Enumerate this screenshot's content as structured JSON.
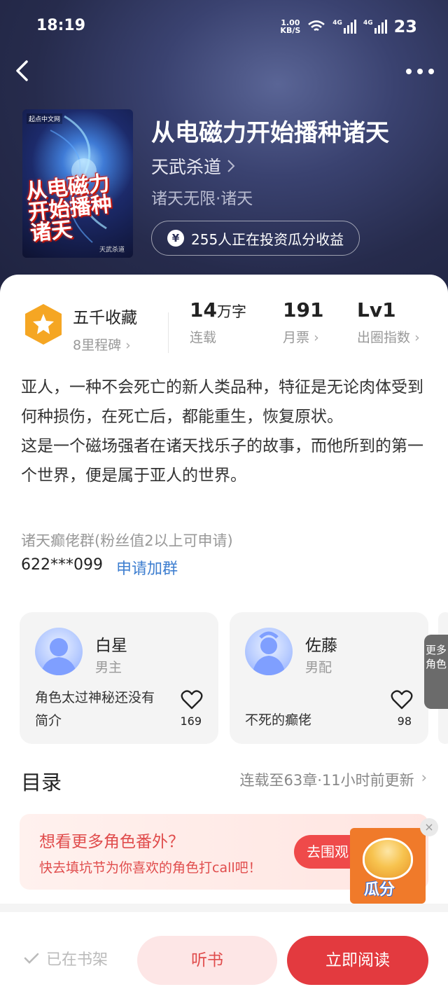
{
  "status_bar": {
    "time": "18:19",
    "net_speed_value": "1.00",
    "net_speed_unit": "KB/S",
    "signal1": "4G",
    "signal2": "4G",
    "battery": "23"
  },
  "book": {
    "title": "从电磁力开始播种诸天",
    "author": "天武杀道",
    "genre": "诸天无限·诸天",
    "invest_text": "255人正在投资瓜分收益",
    "cover": {
      "publisher": "起点中文网",
      "title": "从电磁力开始播种诸天",
      "author": "天武杀道"
    }
  },
  "stats": {
    "collect_value": "五千收藏",
    "collect_label": "8里程碑",
    "words_number": "14",
    "words_unit": "万字",
    "words_label": "连载",
    "monthly_value": "191",
    "monthly_label": "月票",
    "level_value": "Lv1",
    "level_label": "出圈指数"
  },
  "description": {
    "line1": "亚人，一种不会死亡的新人类品种，特征是无论肉体受到何种损伤，在死亡后，都能重生，恢复原状。",
    "line2": "这是一个磁场强者在诸天找乐子的故事，而他所到的第一个世界，便是属于亚人的世界。"
  },
  "fan_group": {
    "name": "诸天癫佬群(粉丝值2以上可申请)",
    "number": "622***099",
    "apply_label": "申请加群"
  },
  "roles": [
    {
      "name": "白星",
      "tag": "男主",
      "desc": "角色太过神秘还没有简介",
      "likes": "169"
    },
    {
      "name": "佐藤",
      "tag": "男配",
      "desc": "不死的癫佬",
      "likes": "98"
    }
  ],
  "more_roles_label": "更多角色",
  "toc": {
    "title": "目录",
    "meta": "连载至63章·11小时前更新"
  },
  "banner": {
    "title": "想看更多角色番外？",
    "subtitle": "快去填坑节为你喜欢的角色打call吧！",
    "button": "去围观",
    "badge_label": "瓜分",
    "close": "×"
  },
  "bottom_bar": {
    "shelf_label": "已在书架",
    "listen_label": "听书",
    "read_label": "立即阅读"
  },
  "colors": {
    "accent_red": "#e33a3f",
    "link_blue": "#3f7fd0",
    "hero_bg": "#262b4c",
    "badge_orange": "#f5a623"
  }
}
